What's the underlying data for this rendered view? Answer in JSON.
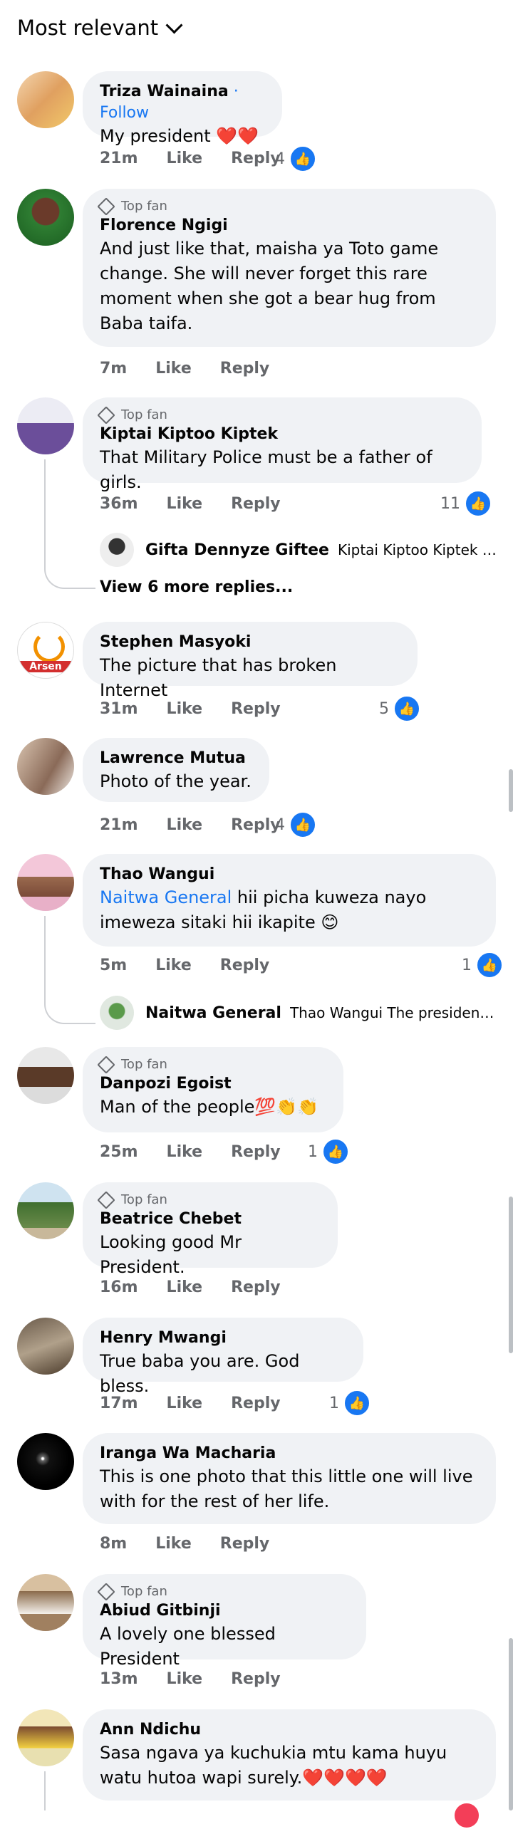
{
  "sort": {
    "label": "Most relevant"
  },
  "colors": {
    "accent": "#1877f2",
    "bubble": "#f0f2f5",
    "secondary": "#65676b"
  },
  "common": {
    "like": "Like",
    "reply": "Reply",
    "top_fan": "Top fan"
  },
  "comments": [
    {
      "name": "Triza Wainaina",
      "follow": " · Follow",
      "text": "My president ❤️❤️",
      "time": "21m",
      "reactions": "4"
    },
    {
      "name": "Florence Ngigi",
      "text": "And just like that, maisha ya Toto game change. She will never forget this rare moment when she got a bear hug from Baba taifa.",
      "time": "7m"
    },
    {
      "name": "Kiptai Kiptoo Kiptek",
      "text": "That Military Police must be a father of girls.",
      "time": "36m",
      "reactions": "11",
      "reply_preview": {
        "name": "Gifta Dennyze Giftee",
        "text": "Kiptai Kiptoo Kiptek yes ban..."
      },
      "more_replies": "View 6 more replies..."
    },
    {
      "name": "Stephen Masyoki",
      "text": "The picture that has broken Internet",
      "time": "31m",
      "reactions": "5",
      "avatar_text": "Arsen"
    },
    {
      "name": "Lawrence Mutua",
      "text": "Photo of the year.",
      "time": "21m",
      "reactions": "4"
    },
    {
      "name": "Thao Wangui",
      "mention": "Naitwa General",
      "text": " hii picha kuweza nayo imeweza sitaki hii ikapite 😊",
      "time": "5m",
      "reactions": "1",
      "reply_preview": {
        "name": "Naitwa General",
        "text": "Thao Wangui The president of all..."
      }
    },
    {
      "name": "Danpozi Egoist",
      "text": "Man of the people💯👏👏",
      "time": "25m",
      "reactions": "1"
    },
    {
      "name": "Beatrice Chebet",
      "text": "Looking good Mr President.",
      "time": "16m"
    },
    {
      "name": "Henry Mwangi",
      "text": "True baba you are. God bless.",
      "time": "17m",
      "reactions": "1"
    },
    {
      "name": "Iranga Wa Macharia",
      "text": "This is one photo that this little one will live with for the rest of her life.",
      "time": "8m"
    },
    {
      "name": "Abiud Gitbinji",
      "text": "A lovely one blessed President",
      "time": "13m"
    },
    {
      "name": "Ann Ndichu",
      "text": "Sasa ngava ya kuchukia mtu kama huyu watu hutoa wapi surely.❤️❤️❤️❤️"
    }
  ]
}
